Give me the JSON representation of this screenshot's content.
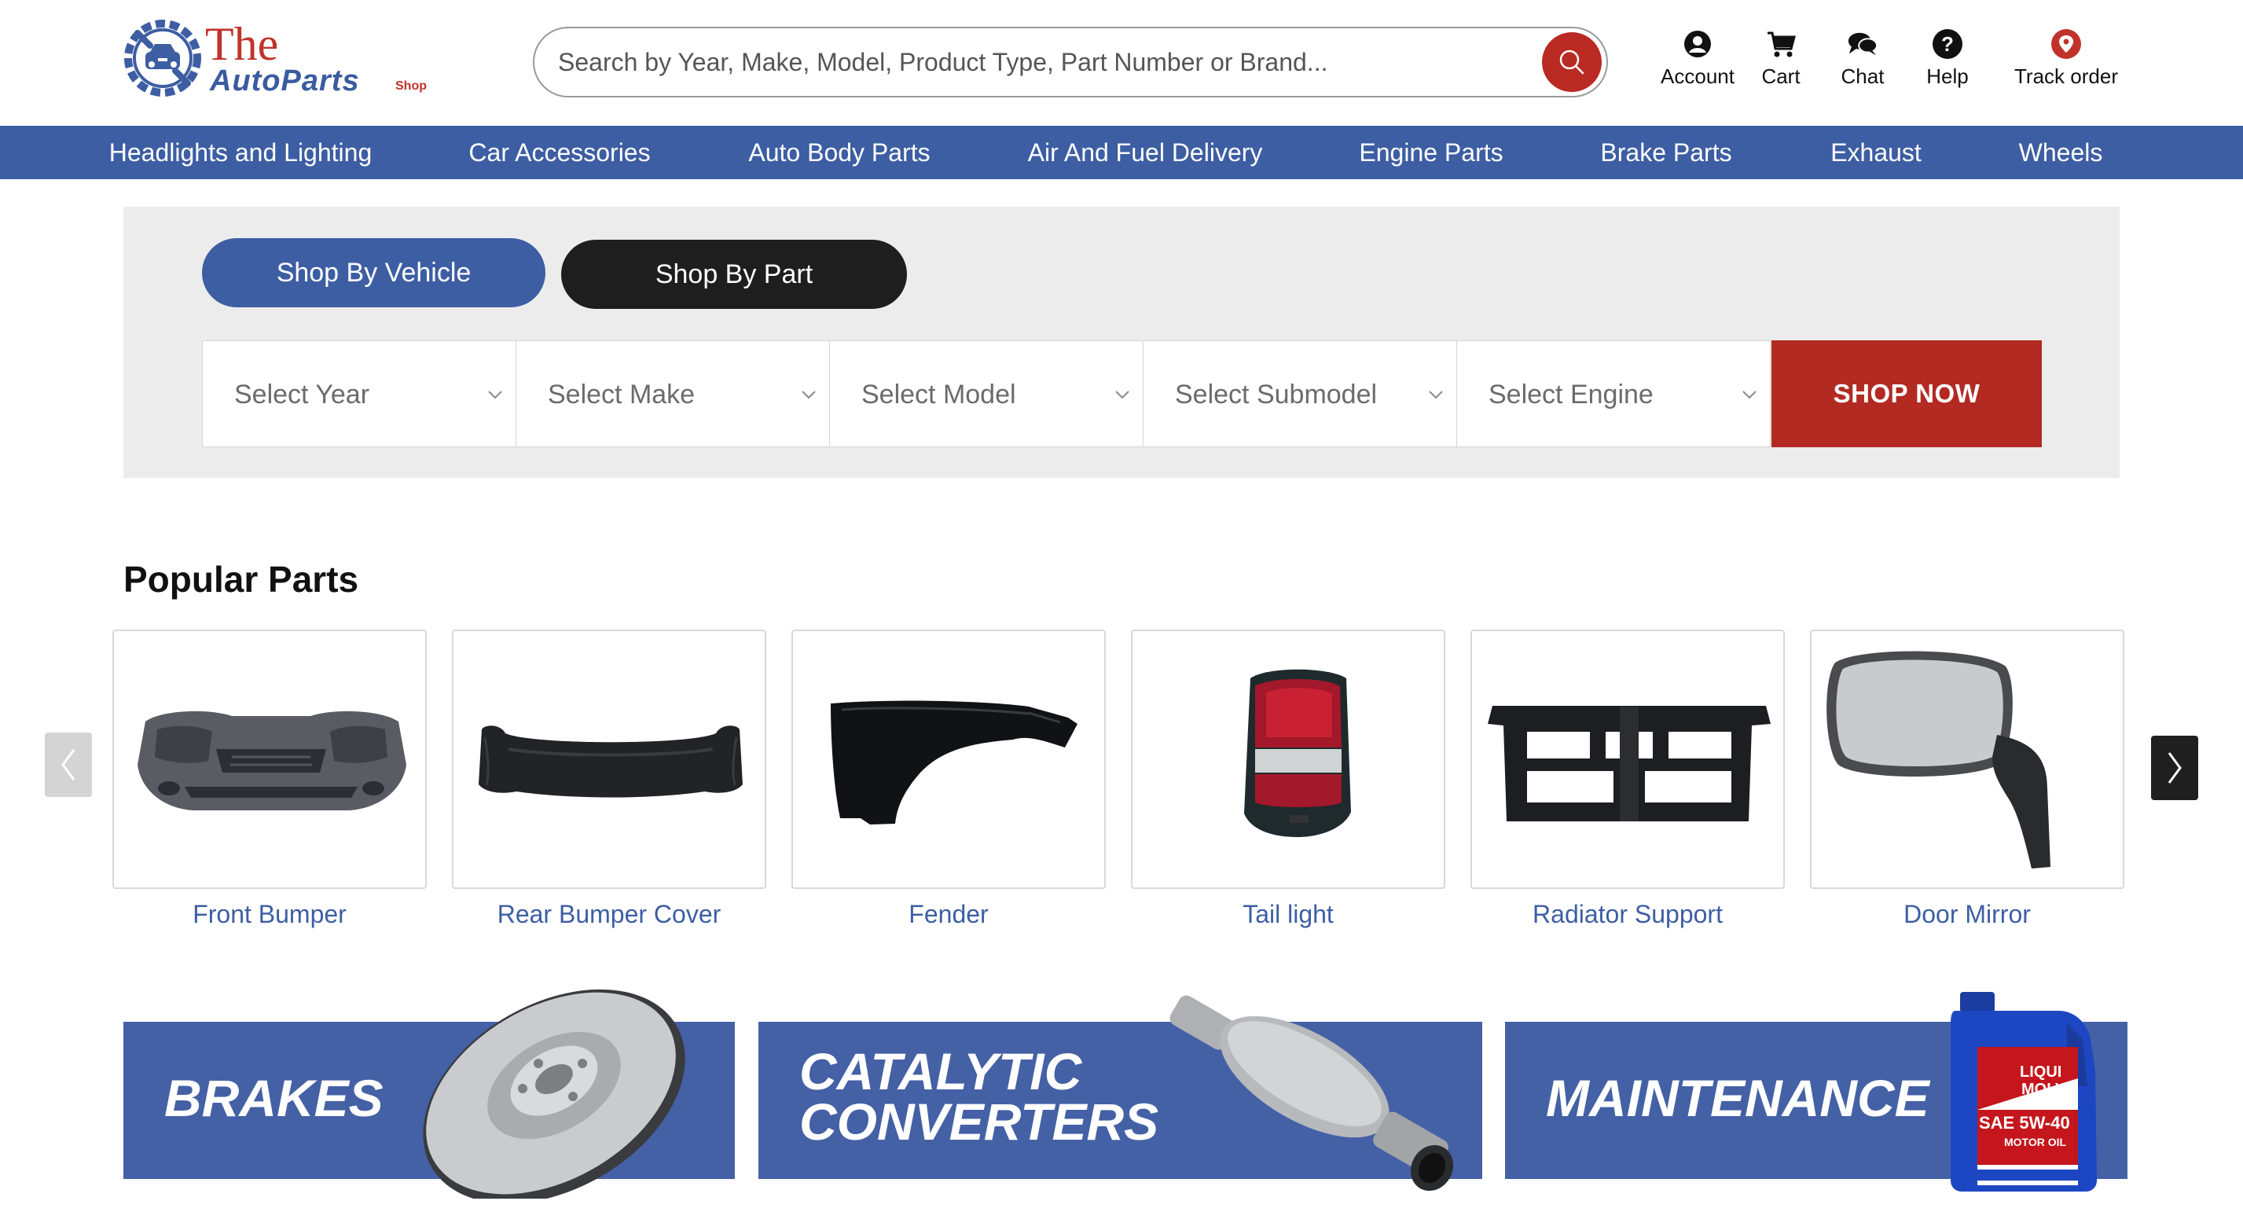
{
  "header": {
    "logo": {
      "line1": "The",
      "line2": "AutoParts",
      "tag": "Shop"
    },
    "search": {
      "placeholder": "Search by Year, Make, Model, Product Type, Part Number or Brand..."
    },
    "links": [
      {
        "label": "Account",
        "icon": "account-icon"
      },
      {
        "label": "Cart",
        "icon": "cart-icon"
      },
      {
        "label": "Chat",
        "icon": "chat-icon"
      },
      {
        "label": "Help",
        "icon": "help-icon"
      },
      {
        "label": "Track order",
        "icon": "location-pin-icon"
      }
    ]
  },
  "nav": {
    "items": [
      "Headlights and Lighting",
      "Car Accessories",
      "Auto Body Parts",
      "Air And Fuel Delivery",
      "Engine Parts",
      "Brake Parts",
      "Exhaust",
      "Wheels"
    ]
  },
  "finder": {
    "tabs": {
      "vehicle": "Shop By Vehicle",
      "part": "Shop By Part"
    },
    "selects": {
      "year": "Select Year",
      "make": "Select Make",
      "model": "Select Model",
      "submodel": "Select Submodel",
      "engine": "Select Engine"
    },
    "submit": "SHOP NOW"
  },
  "popular": {
    "title": "Popular Parts",
    "items": [
      {
        "label": "Front Bumper"
      },
      {
        "label": "Rear Bumper Cover"
      },
      {
        "label": "Fender"
      },
      {
        "label": "Tail light"
      },
      {
        "label": "Radiator Support"
      },
      {
        "label": "Door Mirror"
      }
    ]
  },
  "banners": {
    "brakes": "BRAKES",
    "catalytic_line1": "CATALYTIC",
    "catalytic_line2": "CONVERTERS",
    "maintenance": "MAINTENANCE",
    "oil_brand_line1": "LIQUI",
    "oil_brand_line2": "MOLY",
    "oil_grade": "SAE 5W-40",
    "oil_type": "MOTOR OIL"
  },
  "colors": {
    "brand_blue": "#3d5ea3",
    "brand_red": "#b22a22",
    "banner_blue": "#4461a6",
    "finder_bg": "#ececec"
  }
}
